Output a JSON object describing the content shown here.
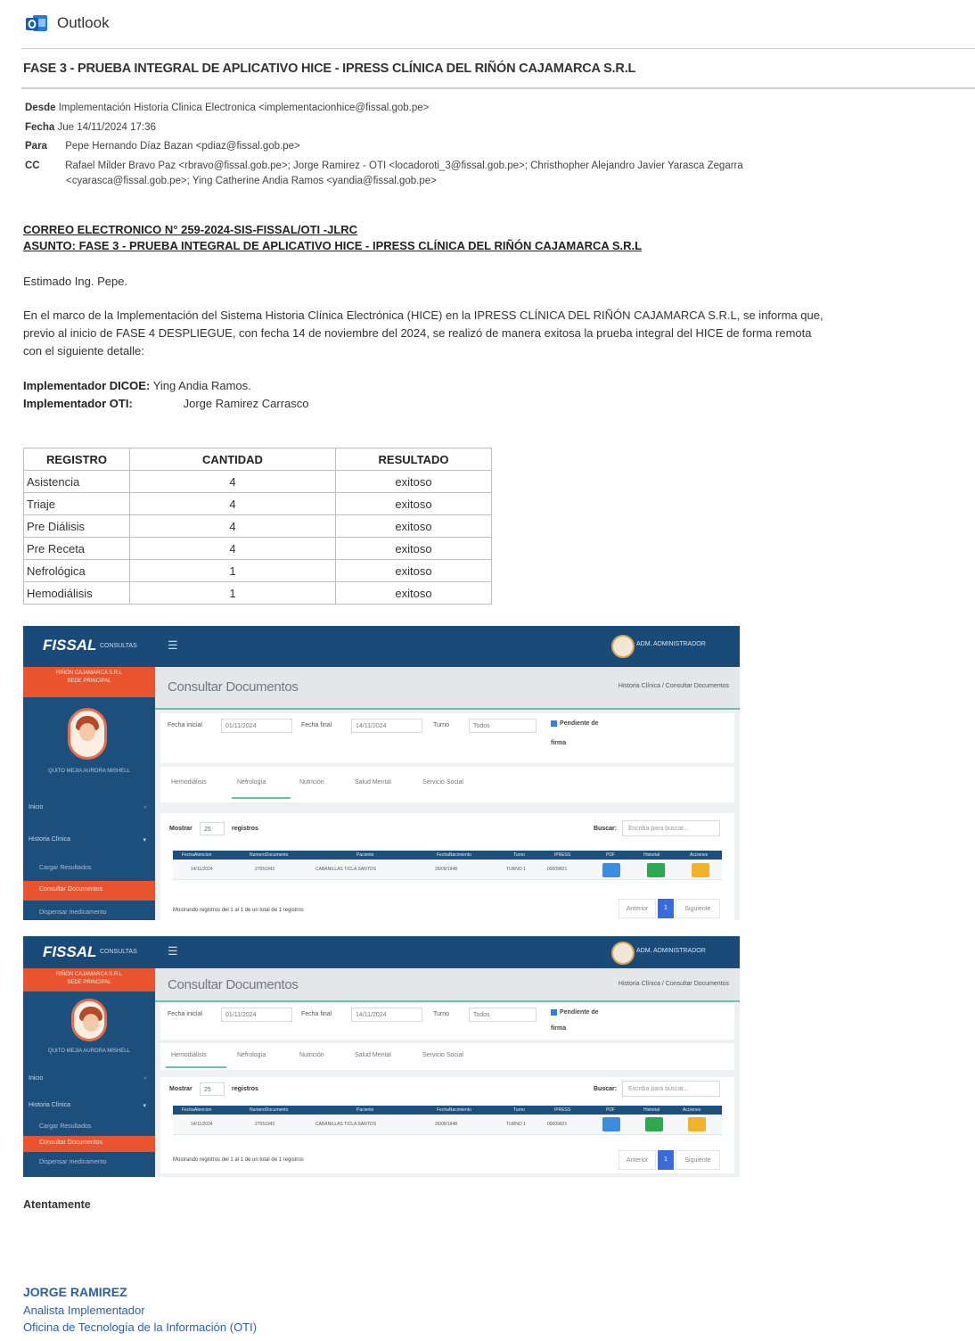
{
  "app": {
    "name": "Outlook"
  },
  "email": {
    "subject": "FASE 3 - PRUEBA INTEGRAL DE APLICATIVO HICE - IPRESS CLÍNICA DEL RIÑÓN CAJAMARCA S.R.L",
    "from_label": "Desde",
    "from_value": "Implementación Historia Clinica Electronica <implementacionhice@fissal.gob.pe>",
    "date_label": "Fecha",
    "date_value": "Jue 14/11/2024 17:36",
    "to_label": "Para",
    "to_value": "Pepe Hernando Díaz Bazan <pdiaz@fissal.gob.pe>",
    "cc_label": "CC",
    "cc_line1": "Rafael Milder Bravo Paz <rbravo@fissal.gob.pe>; Jorge Ramirez - OTI <locadoroti_3@fissal.gob.pe>; Christhopher Alejandro Javier Yarasca Zegarra",
    "cc_line2": "<cyarasca@fissal.gob.pe>; Ying Catherine Andia Ramos <yandia@fissal.gob.pe>",
    "ref_number": "CORREO ELECTRONICO N° 259-2024-SIS-FISSAL/OTI -JLRC",
    "ref_subject": "ASUNTO: FASE 3 - PRUEBA INTEGRAL DE APLICATIVO HICE - IPRESS CLÍNICA DEL RIÑÓN CAJAMARCA S.R.L",
    "greeting": "Estimado Ing. Pepe.",
    "para_line1": "En el marco de la Implementación del Sistema Historia Clínica Electrónica (HICE) en la IPRESS CLÍNICA DEL RIÑÓN CAJAMARCA S.R.L, se informa que,",
    "para_line2": "previo al inicio de FASE 4 DESPLIEGUE, con fecha 14 de noviembre del 2024, se realizó de manera exitosa la prueba integral del HICE de forma remota",
    "para_line3": "con el siguiente detalle:",
    "impl_dicoe_label": "Implementador DICOE:",
    "impl_dicoe_value": "Ying Andia Ramos.",
    "impl_oti_label": "Implementador OTI:",
    "impl_oti_value": "Jorge Ramirez Carrasco",
    "closing": "Atentamente",
    "sig_name": "JORGE RAMIREZ",
    "sig_role": "Analista Implementador",
    "sig_office": "Oficina de Tecnología de la Información (OTI)"
  },
  "results_table": {
    "headers": [
      "REGISTRO",
      "CANTIDAD",
      "RESULTADO"
    ],
    "rows": [
      [
        "Asistencia",
        "4",
        "exitoso"
      ],
      [
        "Triaje",
        "4",
        "exitoso"
      ],
      [
        "Pre Diálisis",
        "4",
        "exitoso"
      ],
      [
        "Pre Receta",
        "4",
        "exitoso"
      ],
      [
        "Nefrológica",
        "1",
        "exitoso"
      ],
      [
        "Hemodiálisis",
        "1",
        "exitoso"
      ]
    ]
  },
  "screenshot": {
    "brand": "FISSAL",
    "brand_sub": "CONSULTAS",
    "admin": "ADM. ADMINISTRADOR",
    "sidebar_banner_1": "RIÑÓN CAJAMARCA S.R.L",
    "sidebar_banner_2": "SEDE PRINCIPAL",
    "sidebar_user": "QUITO MEJIA AURORA MISHELL",
    "nav_inicio": "Inicio",
    "nav_historia": "Historia Clínica",
    "nav_cargar": "Cargar Resultados",
    "nav_consultar": "Consultar Documentos",
    "nav_dispensar": "Dispensar medicamento",
    "page_title": "Consultar Documentos",
    "breadcrumb": "Historia Clínica  /  Consultar Documentos",
    "fecha_inicial_label": "Fecha inicial",
    "fecha_inicial_value": "01/11/2024",
    "fecha_final_label": "Fecha final",
    "fecha_final_value": "14/11/2024",
    "turno_label": "Turno",
    "turno_value": "Todos",
    "pendiente_1": "Pendiente de",
    "pendiente_2": "firma",
    "tabs": [
      "Hemodiálisis",
      "Nefrología",
      "Nutrición",
      "Salud Mental",
      "Servicio Social"
    ],
    "mostrar": "Mostrar",
    "page_size": "25",
    "registros": "registros",
    "buscar": "Buscar:",
    "buscar_placeholder": "Escriba para buscar...",
    "columns": [
      "FechaAtencion",
      "NumeroDocumento",
      "Paciente",
      "FechaNacimiento",
      "Turno",
      "IPRESS",
      "PDF",
      "Historial",
      "Acciones"
    ],
    "row": [
      "14/11/2024",
      "27051942",
      "CABANILLAS TICLA SANTOS",
      "26/09/1948",
      "TURNO 1",
      "00009821"
    ],
    "showing": "Mostrando registros del 1 al 1 de un total de 1 registros",
    "prev": "Anterior",
    "page": "1",
    "next": "Siguiente"
  }
}
